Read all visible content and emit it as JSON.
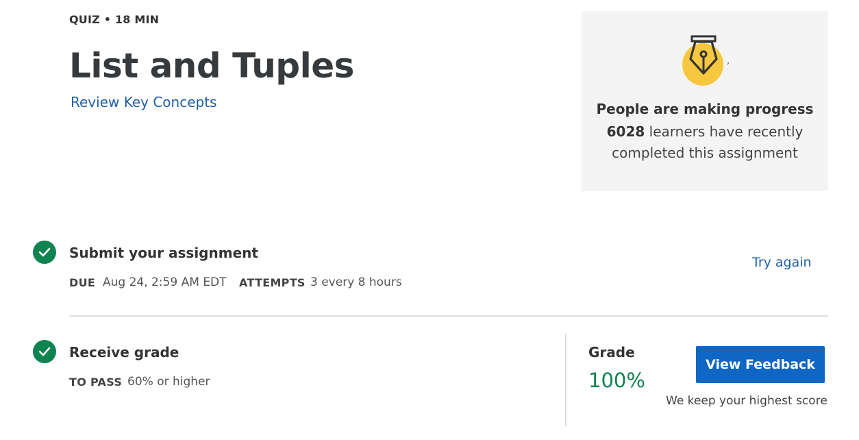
{
  "header": {
    "kicker": "QUIZ • 18 MIN",
    "title": "List and Tuples",
    "review_link": "Review Key Concepts"
  },
  "progress_card": {
    "icon": "pen-nib-icon",
    "tick": ",",
    "heading": "People are making progress",
    "count": "6028",
    "line1_rest": " learners have recently",
    "line2": "completed this assignment"
  },
  "submit": {
    "title": "Submit your assignment",
    "due_label": "DUE",
    "due_value": "Aug 24, 2:59 AM EDT",
    "attempts_label": "ATTEMPTS",
    "attempts_value": "3 every 8 hours",
    "try_again": "Try again"
  },
  "grade_section": {
    "title": "Receive grade",
    "pass_label": "TO PASS",
    "pass_value": "60% or higher",
    "grade_label": "Grade",
    "grade_value": "100%",
    "view_feedback": "View Feedback",
    "note": "We keep your highest score"
  },
  "colors": {
    "accent_blue": "#0f66c4",
    "link_blue": "#1f5fa8",
    "success_green": "#0f8450",
    "card_bg": "#f4f4f4",
    "icon_yellow": "#f7c740"
  }
}
